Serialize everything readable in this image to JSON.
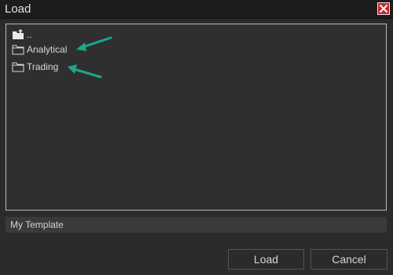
{
  "window": {
    "title": "Load",
    "close_icon": "close-icon"
  },
  "file_list": {
    "items": [
      {
        "label": "..",
        "icon": "folder-up-icon"
      },
      {
        "label": "Analytical",
        "icon": "folder-icon"
      },
      {
        "label": "Trading",
        "icon": "folder-icon"
      }
    ]
  },
  "annotations": {
    "arrow_color": "#1aa88a"
  },
  "template_name": {
    "value": "My Template"
  },
  "buttons": {
    "load_label": "Load",
    "cancel_label": "Cancel"
  },
  "colors": {
    "background": "#2b2b2b",
    "titlebar": "#1c1c1c",
    "close_button": "#c8262d"
  }
}
